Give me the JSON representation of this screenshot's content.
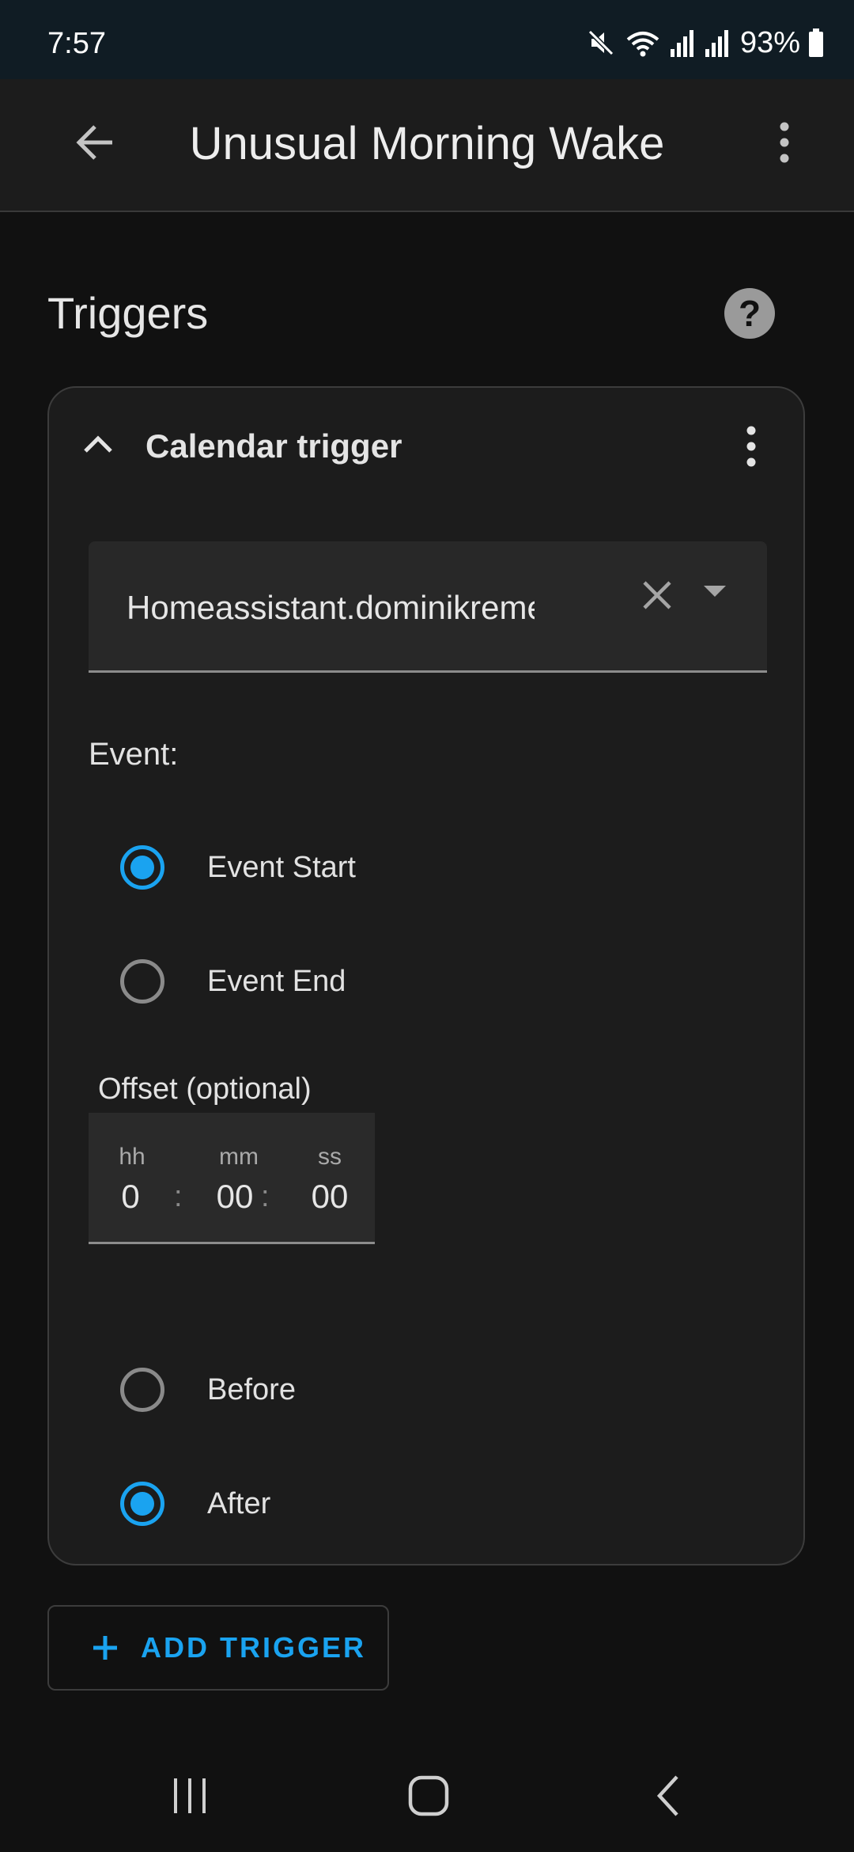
{
  "status_bar": {
    "time": "7:57",
    "battery_percent": "93%",
    "icons": [
      "mute-icon",
      "wifi-icon",
      "signal-icon",
      "signal-icon",
      "battery-icon"
    ]
  },
  "app_bar": {
    "title": "Unusual Morning Wake",
    "back_icon": "arrow-left-icon",
    "menu_icon": "more-vertical-icon"
  },
  "section": {
    "title": "Triggers",
    "help_symbol": "?"
  },
  "trigger_card": {
    "title": "Calendar trigger",
    "calendar_select": {
      "value": "Homeassistant.dominikremes@gmail.com"
    },
    "event_group": {
      "label": "Event:",
      "options": [
        {
          "label": "Event Start",
          "checked": true
        },
        {
          "label": "Event End",
          "checked": false
        }
      ]
    },
    "offset": {
      "label": "Offset (optional)",
      "units": {
        "hours": "hh",
        "minutes": "mm",
        "seconds": "ss"
      },
      "values": {
        "hours": "0",
        "minutes": "00",
        "seconds": "00"
      },
      "separator": ":"
    },
    "offset_type": {
      "options": [
        {
          "label": "Before",
          "checked": false
        },
        {
          "label": "After",
          "checked": true
        }
      ]
    }
  },
  "add_trigger": {
    "symbol": "+",
    "label": "ADD TRIGGER"
  },
  "colors": {
    "accent": "#1aa3f0",
    "background": "#111111",
    "card": "#1c1c1c",
    "status_bar": "#101c24"
  }
}
